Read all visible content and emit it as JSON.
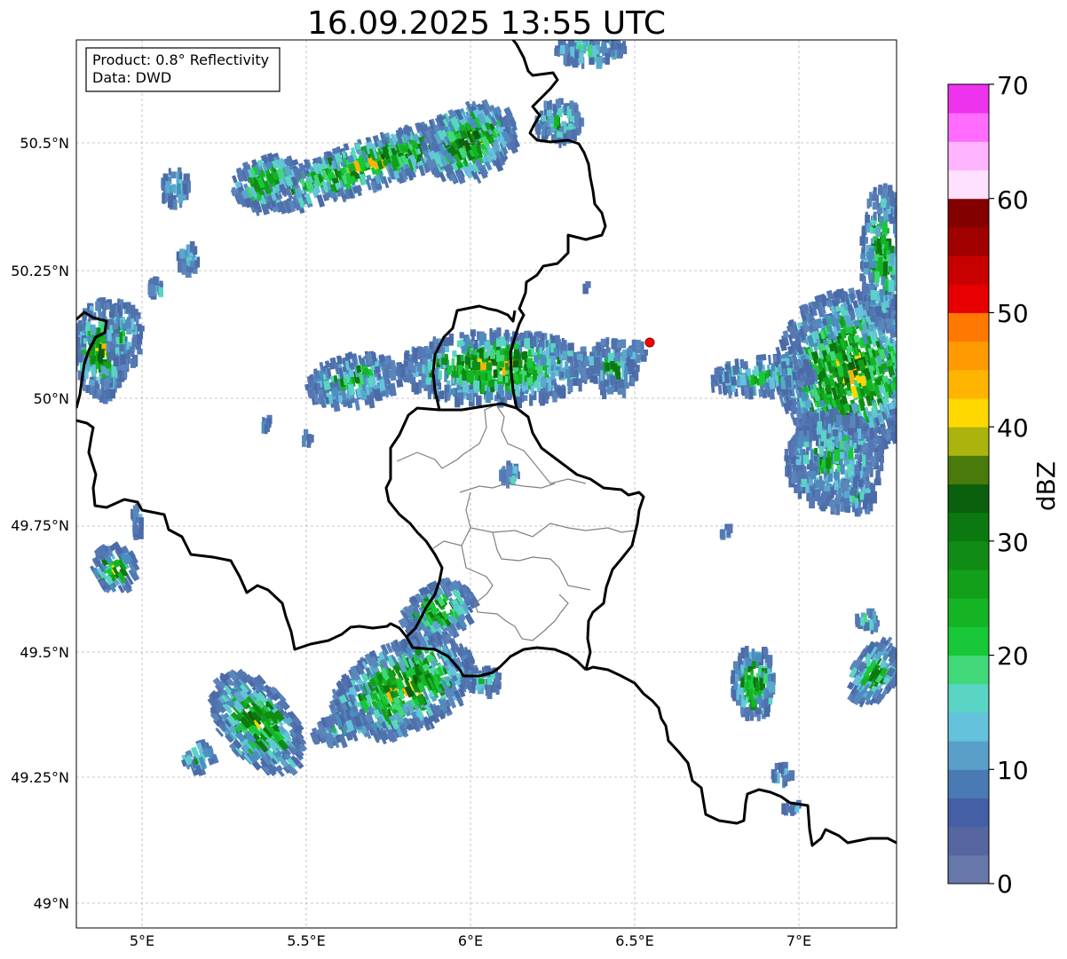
{
  "title": "16.09.2025 13:55 UTC",
  "info_box": {
    "line1": "Product: 0.8° Reflectivity",
    "line2": "Data: DWD"
  },
  "lat_ticks": [
    "50.5°N",
    "50.25°N",
    "50°N",
    "49.75°N",
    "49.5°N",
    "49.25°N",
    "49°N"
  ],
  "lon_ticks": [
    "5°E",
    "5.5°E",
    "6°E",
    "6.5°E",
    "7°E"
  ],
  "colorbar": {
    "label": "dBZ",
    "tick_labels": [
      "0",
      "10",
      "20",
      "30",
      "40",
      "50",
      "60",
      "70"
    ],
    "colors": [
      "#6677aa",
      "#5566a0",
      "#445fa6",
      "#4a7ab4",
      "#58a0c8",
      "#64c2dc",
      "#5ad4c4",
      "#40d878",
      "#18c838",
      "#14b424",
      "#12a01a",
      "#108c14",
      "#0c7810",
      "#0a600c",
      "#4a7a0c",
      "#aab40c",
      "#ffd800",
      "#ffb400",
      "#ff9a00",
      "#ff7800",
      "#e60000",
      "#c80000",
      "#a00000",
      "#820000",
      "#ffe0ff",
      "#ffb4ff",
      "#ff6cff",
      "#ee33ee"
    ]
  },
  "radar_marker": {
    "color": "#ff0000"
  }
}
